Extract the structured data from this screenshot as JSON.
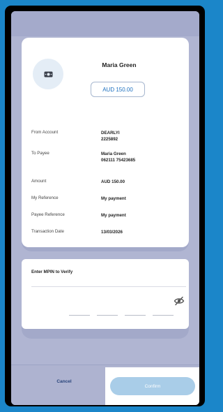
{
  "summary": {
    "payee_name": "Maria Green",
    "amount_badge": "AUD 150.00",
    "payee_icon": "cash-icon",
    "rows": [
      {
        "label": "From Account",
        "value_line1": "DEARLYI",
        "value_line2": "2225892"
      },
      {
        "label": "To Payee",
        "value_line1": "Maria Green",
        "value_line2": "062111 75423685"
      },
      {
        "label": "Amount",
        "value_line1": "AUD 150.00",
        "value_line2": ""
      },
      {
        "label": "My Reference",
        "value_line1": "My payment",
        "value_line2": ""
      },
      {
        "label": "Payee Reference",
        "value_line1": "My payment",
        "value_line2": ""
      },
      {
        "label": "Transaction Date",
        "value_line1": "13/03/2026",
        "value_line2": ""
      }
    ]
  },
  "mpin": {
    "title": "Enter MPIN to Verify",
    "slots": 4,
    "visibility_icon": "eye-slash-icon"
  },
  "footer": {
    "cancel_label": "Cancel",
    "confirm_label": "Confirm"
  },
  "colors": {
    "accent": "#1b6fbf",
    "confirm_disabled": "#a9cde8",
    "overlay": "#b0b5d2",
    "frame_border": "#1b86c9"
  }
}
